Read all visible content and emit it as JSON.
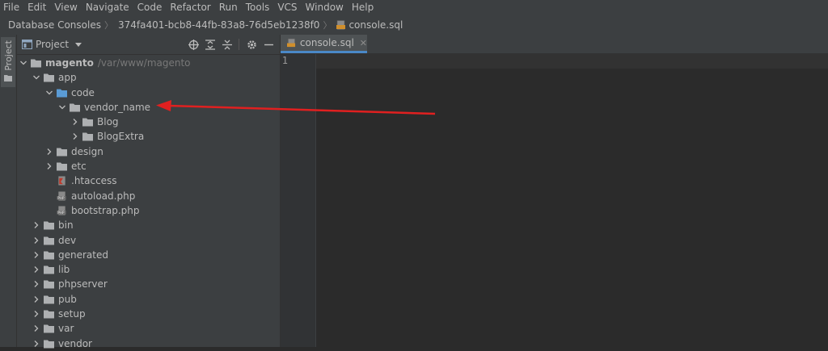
{
  "menu": [
    "File",
    "Edit",
    "View",
    "Navigate",
    "Code",
    "Refactor",
    "Run",
    "Tools",
    "VCS",
    "Window",
    "Help"
  ],
  "breadcrumbs": {
    "root": "Database Consoles",
    "uuid": "374fa401-bcb8-44fb-83a8-76d5eb1238f0",
    "file": "console.sql"
  },
  "sidestripe": {
    "label": "Project"
  },
  "project_panel": {
    "title": "Project"
  },
  "tree": [
    {
      "label": "magento",
      "path": "/var/www/magento",
      "bold": true,
      "icon": "folder-icon",
      "arrow": "down",
      "depth": 0
    },
    {
      "label": "app",
      "icon": "folder-icon",
      "arrow": "down",
      "depth": 1
    },
    {
      "label": "code",
      "icon": "folder-blue-icon",
      "arrow": "down",
      "depth": 2
    },
    {
      "label": "vendor_name",
      "icon": "folder-icon",
      "arrow": "down",
      "depth": 3
    },
    {
      "label": "Blog",
      "icon": "folder-icon",
      "arrow": "right",
      "depth": 4
    },
    {
      "label": "BlogExtra",
      "icon": "folder-icon",
      "arrow": "right",
      "depth": 4
    },
    {
      "label": "design",
      "icon": "folder-icon",
      "arrow": "right",
      "depth": 2
    },
    {
      "label": "etc",
      "icon": "folder-icon",
      "arrow": "right",
      "depth": 2
    },
    {
      "label": ".htaccess",
      "icon": "htaccess-icon",
      "arrow": "none",
      "depth": 2
    },
    {
      "label": "autoload.php",
      "icon": "php-file-icon",
      "arrow": "none",
      "depth": 2
    },
    {
      "label": "bootstrap.php",
      "icon": "php-file-icon",
      "arrow": "none",
      "depth": 2
    },
    {
      "label": "bin",
      "icon": "folder-icon",
      "arrow": "right",
      "depth": 1
    },
    {
      "label": "dev",
      "icon": "folder-icon",
      "arrow": "right",
      "depth": 1
    },
    {
      "label": "generated",
      "icon": "folder-icon",
      "arrow": "right",
      "depth": 1
    },
    {
      "label": "lib",
      "icon": "folder-icon",
      "arrow": "right",
      "depth": 1
    },
    {
      "label": "phpserver",
      "icon": "folder-icon",
      "arrow": "right",
      "depth": 1
    },
    {
      "label": "pub",
      "icon": "folder-icon",
      "arrow": "right",
      "depth": 1
    },
    {
      "label": "setup",
      "icon": "folder-icon",
      "arrow": "right",
      "depth": 1
    },
    {
      "label": "var",
      "icon": "folder-icon",
      "arrow": "right",
      "depth": 1
    },
    {
      "label": "vendor",
      "icon": "folder-icon",
      "arrow": "right",
      "depth": 1
    }
  ],
  "editor": {
    "tab_label": "console.sql",
    "line_number": "1"
  },
  "colors": {
    "background": "#2b2b2b",
    "panel": "#3c3f41",
    "accent": "#4a88c7",
    "annotation_arrow": "#e02020"
  }
}
